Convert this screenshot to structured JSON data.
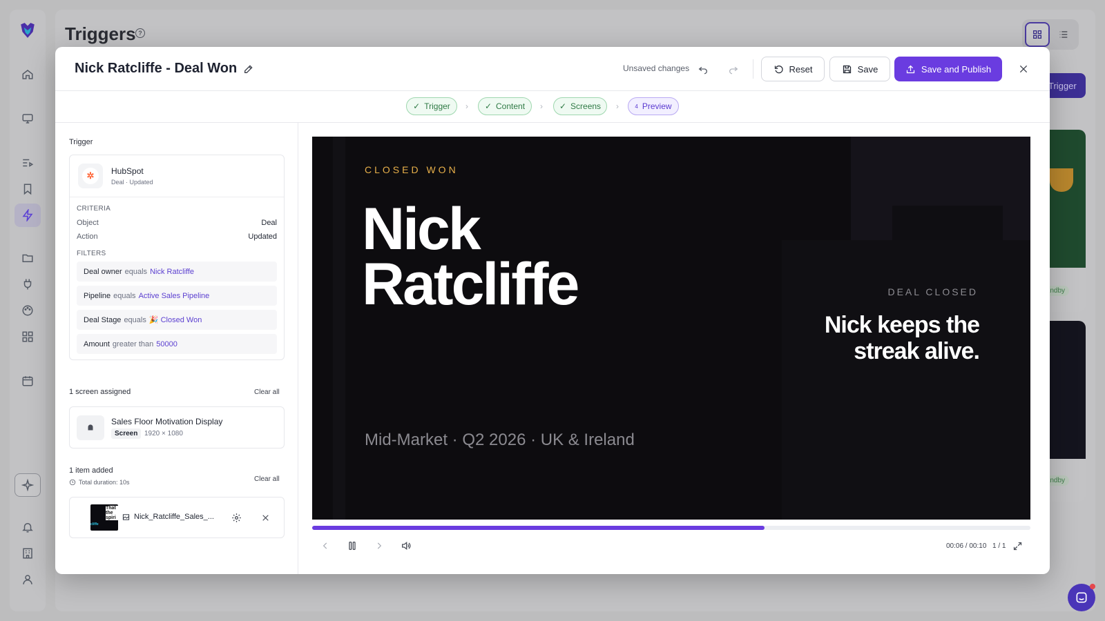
{
  "background": {
    "page_title": "Triggers",
    "help_glyph": "?",
    "new_trigger_label": "Trigger",
    "standby_label_1": "tandby",
    "standby_label_2": "tandby",
    "sidebar_icons": [
      "logo-icon",
      "home-icon",
      "monitor-icon",
      "playlist-icon",
      "bookmark-icon",
      "lightning-icon",
      "folder-icon",
      "plug-icon",
      "palette-icon",
      "apps-icon",
      "calendar-icon",
      "sparkle-icon",
      "bell-icon",
      "building-icon",
      "user-icon"
    ]
  },
  "modal": {
    "title": "Nick Ratcliffe - Deal Won",
    "unsaved": "Unsaved changes",
    "reset": "Reset",
    "save": "Save",
    "publish": "Save and Publish",
    "accent_color": "#6a3ce0"
  },
  "steps": [
    {
      "label": "Trigger",
      "state": "done"
    },
    {
      "label": "Content",
      "state": "done"
    },
    {
      "label": "Screens",
      "state": "done"
    },
    {
      "label": "Preview",
      "state": "current",
      "number": "4"
    }
  ],
  "trigger": {
    "section_label": "Trigger",
    "integration": "HubSpot",
    "event": "Deal · Updated",
    "criteria_label": "CRITERIA",
    "criteria": [
      {
        "key": "Object",
        "value": "Deal"
      },
      {
        "key": "Action",
        "value": "Updated"
      }
    ],
    "filters_label": "FILTERS",
    "filters": [
      {
        "field": "Deal owner",
        "op": "equals",
        "value": "Nick Ratcliffe"
      },
      {
        "field": "Pipeline",
        "op": "equals",
        "value": "Active Sales Pipeline"
      },
      {
        "field": "Deal Stage",
        "op": "equals",
        "value": "🎉 Closed Won"
      },
      {
        "field": "Amount",
        "op": "greater than",
        "value": "50000"
      }
    ]
  },
  "screens": {
    "heading": "1 screen assigned",
    "clear": "Clear all",
    "name": "Sales Floor Motivation Display",
    "badge": "Screen",
    "resolution": "1920 × 1080"
  },
  "items": {
    "heading": "1 item added",
    "clear": "Clear all",
    "duration": "Total duration: 10s",
    "file": "Nick_Ratcliffe_Sales_...",
    "thumb_text": "That the spiri",
    "thumb_side": "cliffe"
  },
  "preview": {
    "kicker": "CLOSED WON",
    "name_line1": "Nick",
    "name_line2": "Ratcliffe",
    "deal_label": "DEAL CLOSED",
    "tagline_line1": "Nick keeps the",
    "tagline_line2": "streak alive.",
    "meta": "Mid-Market · Q2 2026 · UK & Ireland",
    "time": "00:06 / 00:10",
    "page": "1 / 1",
    "progress": 0.63
  }
}
